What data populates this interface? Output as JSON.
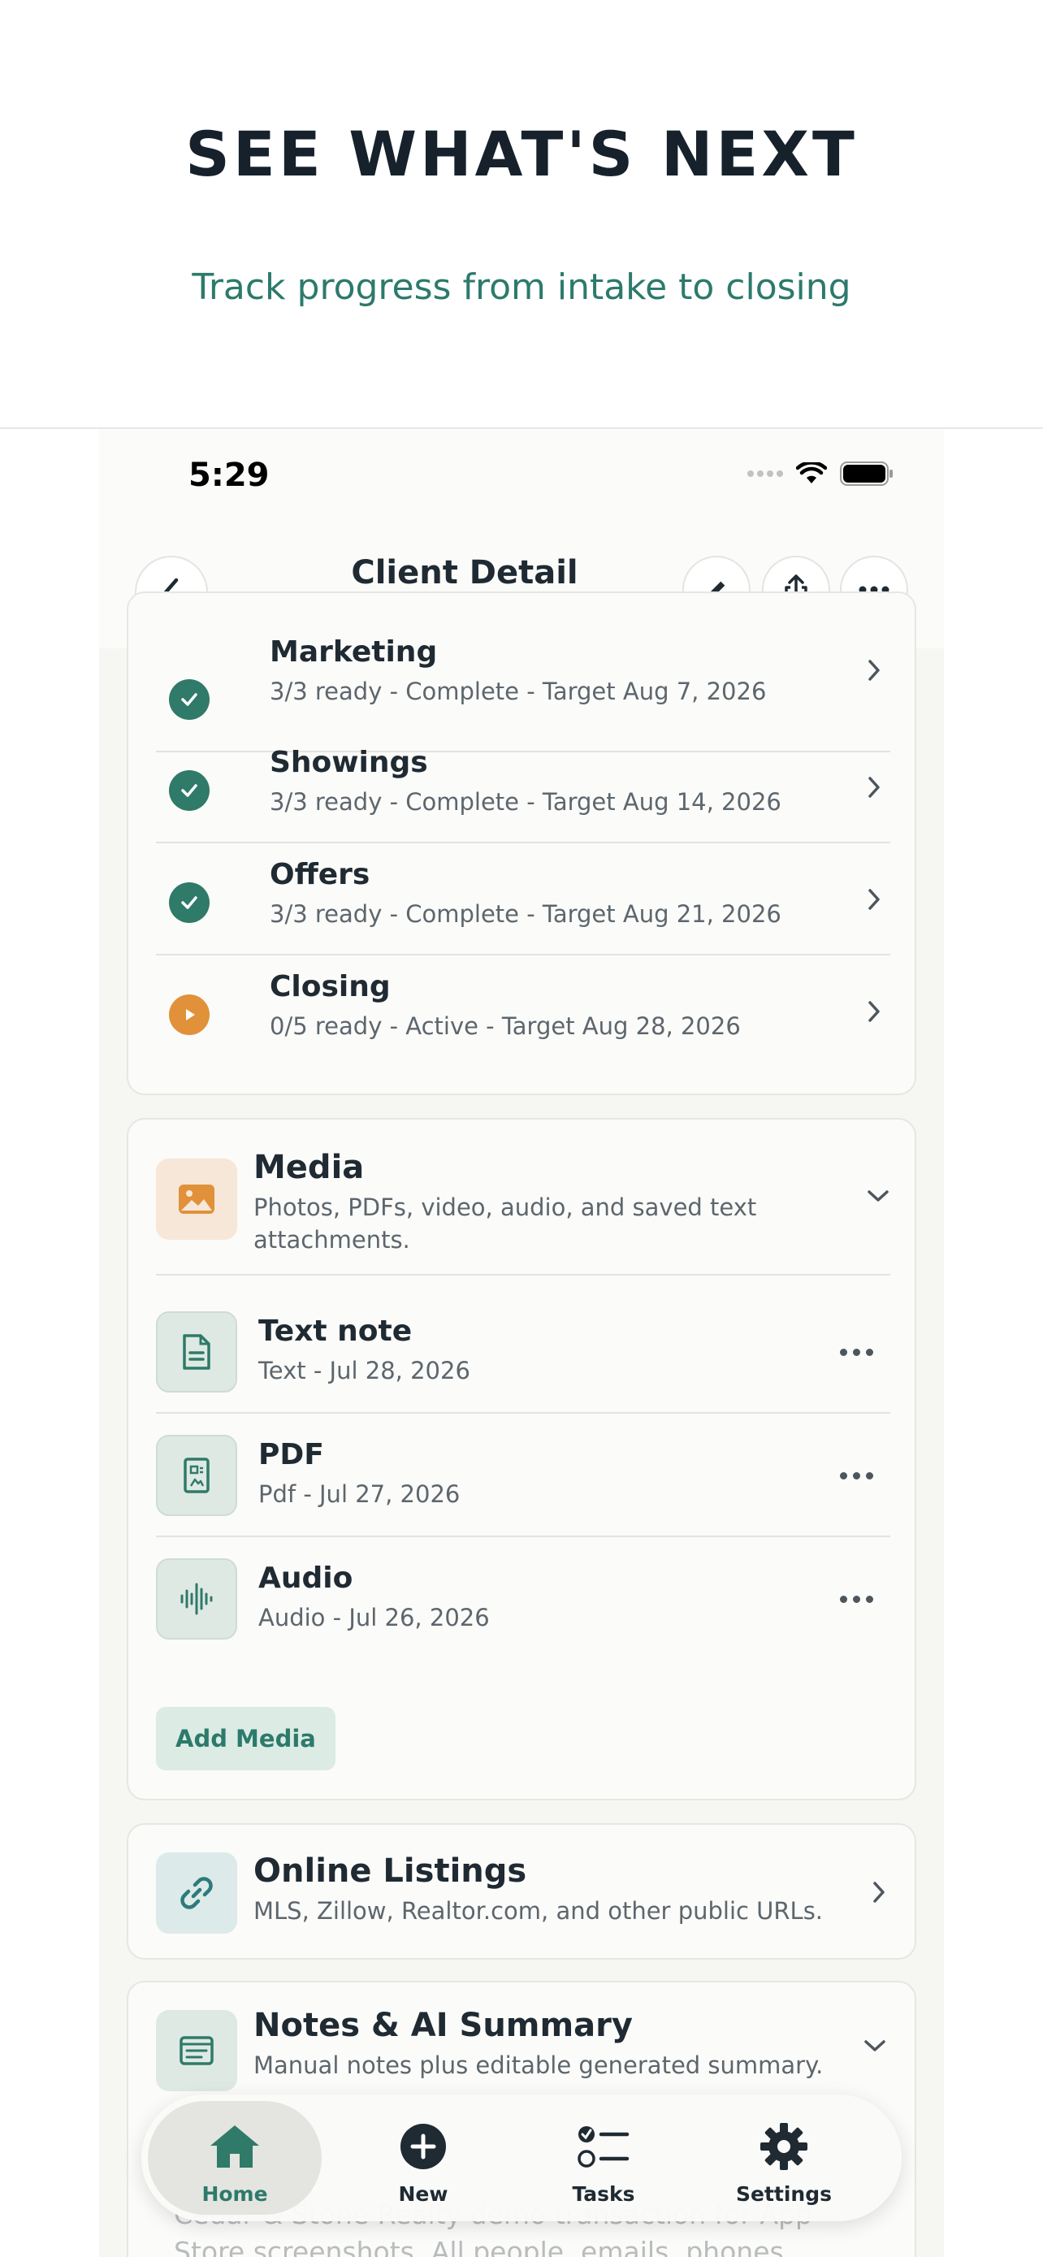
{
  "hero": {
    "title": "SEE WHAT'S NEXT",
    "subtitle": "Track progress from intake to closing"
  },
  "status_bar": {
    "time": "5:29",
    "icons": [
      "signal-icon",
      "wifi-icon",
      "battery-icon"
    ]
  },
  "nav": {
    "title": "Client Detail",
    "back_icon": "chevron-left-icon",
    "actions": [
      "edit-icon",
      "share-icon",
      "more-icon"
    ]
  },
  "phases": [
    {
      "title": "Marketing",
      "subtitle": "3/3 ready - Complete - Target Aug 7, 2026",
      "status": "complete"
    },
    {
      "title": "Showings",
      "subtitle": "3/3 ready - Complete - Target Aug 14, 2026",
      "status": "complete"
    },
    {
      "title": "Offers",
      "subtitle": "3/3 ready - Complete - Target Aug 21, 2026",
      "status": "complete"
    },
    {
      "title": "Closing",
      "subtitle": "0/5 ready - Active - Target Aug 28, 2026",
      "status": "active"
    }
  ],
  "media": {
    "title": "Media",
    "subtitle": "Photos, PDFs, video, audio, and saved text attachments.",
    "items": [
      {
        "title": "Text note",
        "subtitle": "Text - Jul 28, 2026",
        "icon": "document-icon"
      },
      {
        "title": "PDF",
        "subtitle": "Pdf - Jul 27, 2026",
        "icon": "pdf-icon"
      },
      {
        "title": "Audio",
        "subtitle": "Audio - Jul 26, 2026",
        "icon": "waveform-icon"
      }
    ],
    "add_label": "Add Media"
  },
  "listings": {
    "title": "Online Listings",
    "subtitle": "MLS, Zillow, Realtor.com, and other public URLs."
  },
  "notes": {
    "title": "Notes & AI Summary",
    "subtitle": "Manual notes plus editable generated summary.",
    "preview": "Cedar & Stone Realty demo transaction for App Store screenshots. All people, emails, phones"
  },
  "tabs": [
    {
      "label": "Home",
      "icon": "house-icon",
      "active": true
    },
    {
      "label": "New",
      "icon": "plus-circle-icon",
      "active": false
    },
    {
      "label": "Tasks",
      "icon": "checklist-icon",
      "active": false
    },
    {
      "label": "Settings",
      "icon": "gear-icon",
      "active": false
    }
  ],
  "colors": {
    "accent": "#2c7a6b",
    "complete": "#2f7a68",
    "active": "#e0913a",
    "text_primary": "#1f2a33",
    "text_secondary": "#5d666d"
  }
}
